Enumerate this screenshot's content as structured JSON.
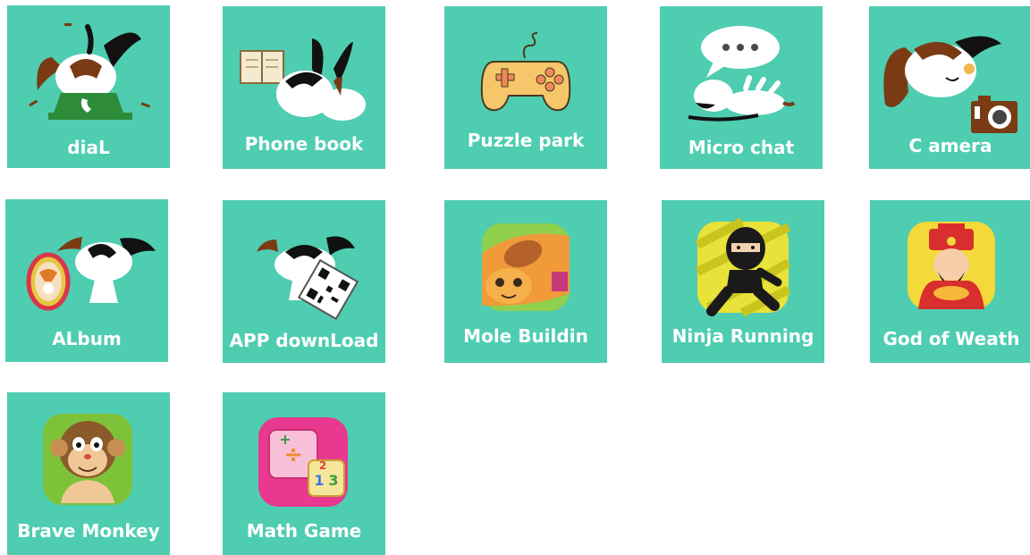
{
  "apps": [
    {
      "label": "diaL",
      "icon": "dog-phone-icon"
    },
    {
      "label": "Phone book",
      "icon": "dog-phonebook-icon"
    },
    {
      "label": "Puzzle park",
      "icon": "gamepad-icon"
    },
    {
      "label": "Micro chat",
      "icon": "dog-chat-icon"
    },
    {
      "label": "C amera",
      "icon": "dog-camera-icon"
    },
    {
      "label": "ALbum",
      "icon": "dog-album-icon"
    },
    {
      "label": "APP downLoad",
      "icon": "dog-qrcode-icon"
    },
    {
      "label": "Mole Buildin",
      "icon": "mole-game-icon"
    },
    {
      "label": "Ninja Running",
      "icon": "ninja-icon"
    },
    {
      "label": "God of Weath",
      "icon": "wealth-god-icon"
    },
    {
      "label": "Brave Monkey",
      "icon": "monkey-icon"
    },
    {
      "label": "Math Game",
      "icon": "math-dice-icon"
    }
  ],
  "colors": {
    "tile": "#4ecdb1",
    "label": "#ffffff"
  }
}
